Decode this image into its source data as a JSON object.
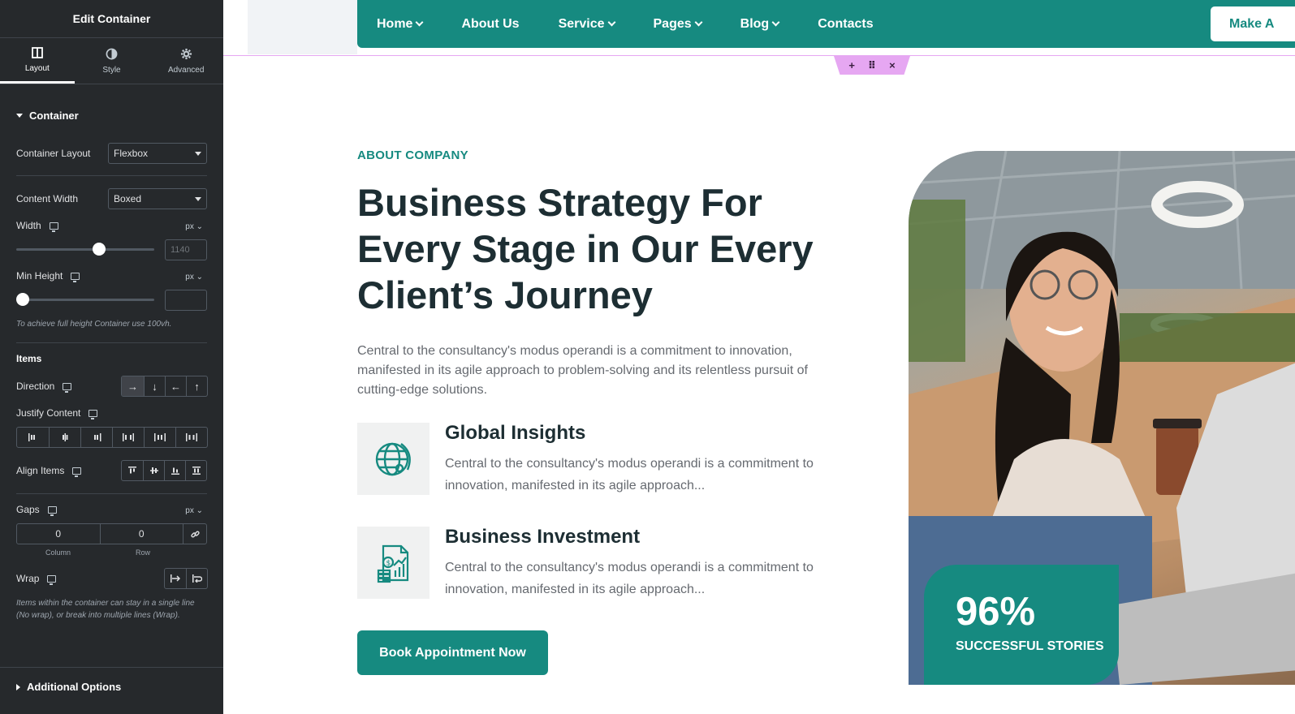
{
  "panel": {
    "title": "Edit Container",
    "tabs": [
      {
        "label": "Layout",
        "icon": "layout-icon",
        "active": true
      },
      {
        "label": "Style",
        "icon": "contrast-icon",
        "active": false
      },
      {
        "label": "Advanced",
        "icon": "gear-icon",
        "active": false
      }
    ],
    "section_container": "Container",
    "container_layout": {
      "label": "Container Layout",
      "value": "Flexbox"
    },
    "content_width": {
      "label": "Content Width",
      "value": "Boxed"
    },
    "width": {
      "label": "Width",
      "unit": "px",
      "placeholder": "1140",
      "slider_fraction": 0.6
    },
    "min_height": {
      "label": "Min Height",
      "unit": "px",
      "value": "",
      "slider_fraction": 0.0
    },
    "min_height_hint": "To achieve full height Container use 100vh.",
    "items_heading": "Items",
    "direction": {
      "label": "Direction",
      "selected": "row"
    },
    "justify_content": {
      "label": "Justify Content"
    },
    "align_items": {
      "label": "Align Items"
    },
    "gaps": {
      "label": "Gaps",
      "unit": "px",
      "column_value": "0",
      "row_value": "0",
      "column_label": "Column",
      "row_label": "Row"
    },
    "wrap": {
      "label": "Wrap"
    },
    "wrap_hint": "Items within the container can stay in a single line (No wrap), or break into multiple lines (Wrap).",
    "additional_options": "Additional Options"
  },
  "nav": {
    "items": [
      {
        "label": "Home",
        "dropdown": true
      },
      {
        "label": "About Us",
        "dropdown": false
      },
      {
        "label": "Service",
        "dropdown": true
      },
      {
        "label": "Pages",
        "dropdown": true
      },
      {
        "label": "Blog",
        "dropdown": true
      },
      {
        "label": "Contacts",
        "dropdown": false
      }
    ],
    "cta": "Make A"
  },
  "hero": {
    "eyebrow": "ABOUT COMPANY",
    "headline": "Business Strategy For Every Stage in Our Every Client’s Journey",
    "lead": "Central to the consultancy's modus operandi is a commitment to innovation, manifested in its agile approach to problem-solving and its relentless pursuit of cutting-edge solutions.",
    "features": [
      {
        "title": "Global Insights",
        "text": "Central to the consultancy's modus operandi is a commitment to innovation, manifested in its agile approach...",
        "icon": "globe-icon"
      },
      {
        "title": "Business Investment",
        "text": "Central to the consultancy's modus operandi is a commitment to innovation, manifested in its agile approach...",
        "icon": "investment-report-icon"
      }
    ],
    "button": "Book Appointment Now",
    "stat": {
      "number": "96%",
      "label": "SUCCESSFUL STORIES"
    }
  },
  "colors": {
    "brand": "#168a80",
    "panel_bg": "#26292c",
    "heading": "#1d2e33",
    "handle": "#e6a7f2"
  }
}
